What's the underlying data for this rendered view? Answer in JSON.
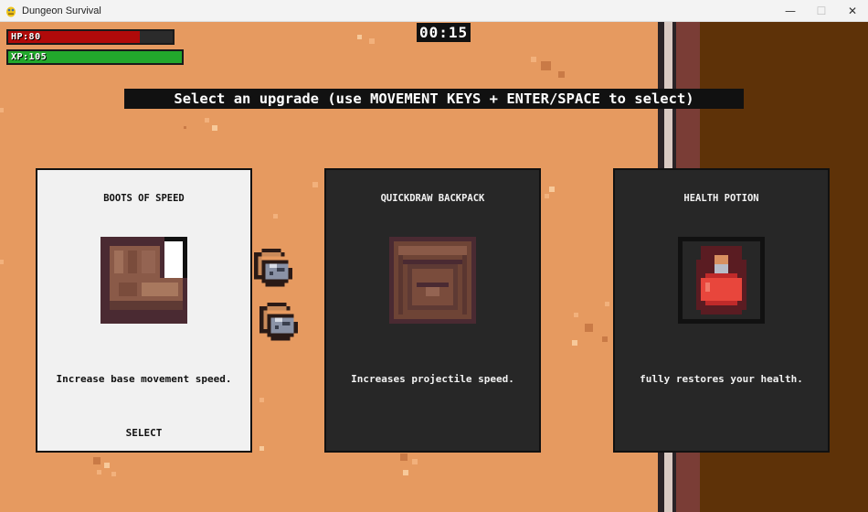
{
  "window": {
    "title": "Dungeon Survival",
    "minimize": "—",
    "maximize": "☐",
    "close": "✕"
  },
  "hud": {
    "hp_label": "HP:80",
    "hp_fraction": 0.8,
    "xp_label": "XP:105",
    "xp_fraction": 1.0,
    "timer": "00:15"
  },
  "instruction": "Select an upgrade (use MOVEMENT KEYS + ENTER/SPACE to select)",
  "cards": [
    {
      "title": "BOOTS OF SPEED",
      "description": "Increase base movement speed.",
      "select_label": "SELECT",
      "icon": "boot-icon"
    },
    {
      "title": "QUICKDRAW BACKPACK",
      "description": "Increases projectile speed.",
      "icon": "backpack-icon"
    },
    {
      "title": "HEALTH POTION",
      "description": "fully restores your health.",
      "icon": "potion-icon"
    }
  ],
  "colors": {
    "ground": "#e69a60",
    "hp": "#b00a0a",
    "xp": "#22a82c",
    "wall": "#5e3208"
  }
}
